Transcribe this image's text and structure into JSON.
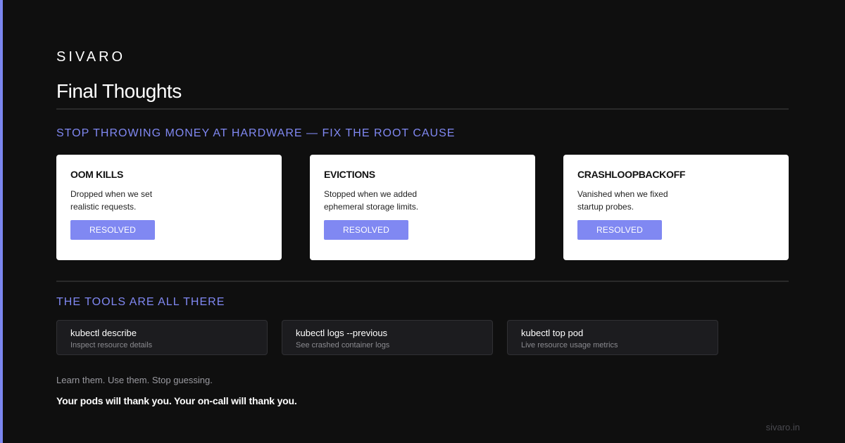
{
  "brand": "SIVARO",
  "title": "Final Thoughts",
  "section1": {
    "heading": "STOP THROWING MONEY AT HARDWARE — FIX THE ROOT CAUSE",
    "cards": [
      {
        "title": "OOM KILLS",
        "body": "Dropped when we set realistic requests.",
        "badge": "RESOLVED"
      },
      {
        "title": "EVICTIONS",
        "body": "Stopped when we added ephemeral storage limits.",
        "badge": "RESOLVED"
      },
      {
        "title": "CRASHLOOPBACKOFF",
        "body": "Vanished when we fixed startup probes.",
        "badge": "RESOLVED"
      }
    ]
  },
  "section2": {
    "heading": "THE TOOLS ARE ALL THERE",
    "tools": [
      {
        "command": "kubectl describe",
        "description": "Inspect resource details"
      },
      {
        "command": "kubectl logs --previous",
        "description": "See crashed container logs"
      },
      {
        "command": "kubectl top pod",
        "description": "Live resource usage metrics"
      }
    ]
  },
  "note": "Learn them. Use them. Stop guessing.",
  "closing": "Your pods will thank you. Your on-call will thank you.",
  "footer": "sivaro.in",
  "colors": {
    "accent": "#8088f2",
    "background": "#0f0f0f",
    "card": "#ffffff"
  }
}
